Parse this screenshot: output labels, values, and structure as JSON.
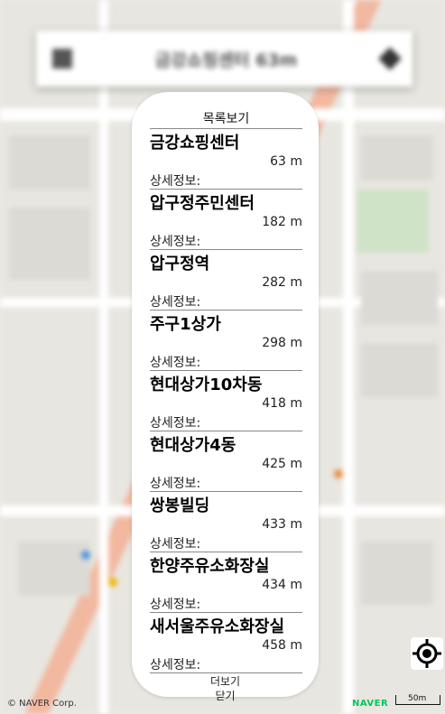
{
  "top_bar": {
    "title": "금강쇼핑센터 63m",
    "menu_icon": "menu-icon",
    "nav_icon": "navigation-icon"
  },
  "panel": {
    "header": "목록보기",
    "items": [
      {
        "name": "금강쇼핑센터",
        "distance": "63 m",
        "detail_label": "상세정보:"
      },
      {
        "name": "압구정주민센터",
        "distance": "182 m",
        "detail_label": "상세정보:"
      },
      {
        "name": "압구정역",
        "distance": "282 m",
        "detail_label": "상세정보:"
      },
      {
        "name": "주구1상가",
        "distance": "298 m",
        "detail_label": "상세정보:"
      },
      {
        "name": "현대상가10차동",
        "distance": "418 m",
        "detail_label": "상세정보:"
      },
      {
        "name": "현대상가4동",
        "distance": "425 m",
        "detail_label": "상세정보:"
      },
      {
        "name": "쌍봉빌딩",
        "distance": "433 m",
        "detail_label": "상세정보:"
      },
      {
        "name": "한양주유소화장실",
        "distance": "434 m",
        "detail_label": "상세정보:"
      },
      {
        "name": "새서울주유소화장실",
        "distance": "458 m",
        "detail_label": "상세정보:"
      }
    ],
    "more_label": "더보기",
    "close_label": "닫기"
  },
  "map": {
    "copyright": "© NAVER Corp.",
    "logo": "NAVER",
    "scale_label": "50m",
    "locate_icon": "my-location-icon"
  },
  "colors": {
    "naver_green": "#03c75a",
    "panel_background": "#ffffff"
  }
}
